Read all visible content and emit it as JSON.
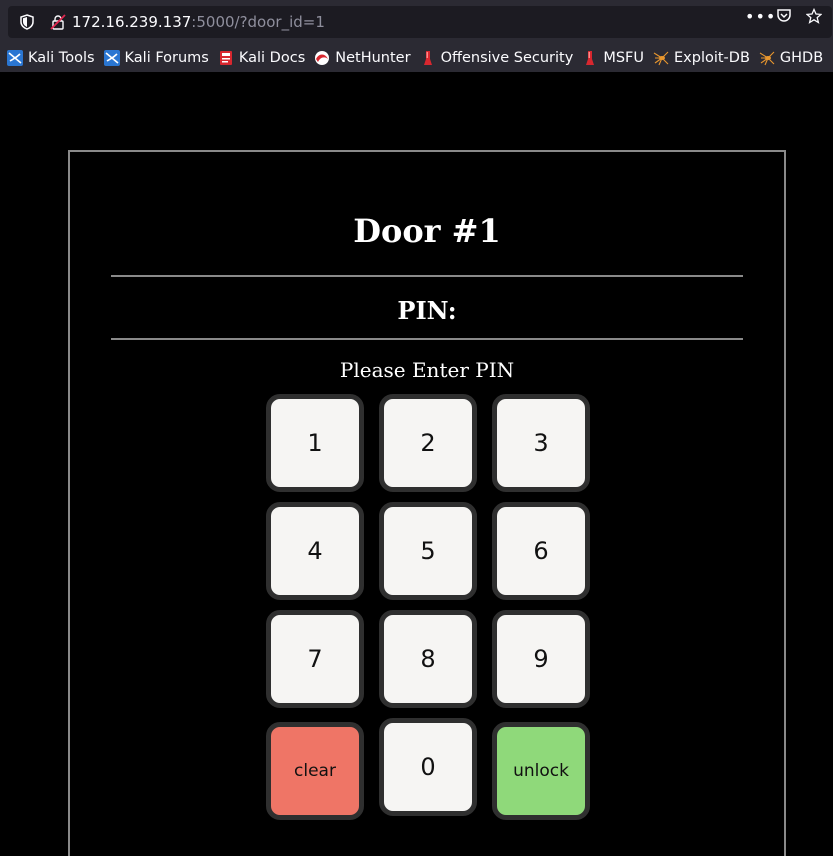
{
  "browser": {
    "url_host": "172.16.239.137",
    "url_rest": ":5000/?door_id=1",
    "more_label": "•••",
    "bookmarks": [
      {
        "label": "Kali Tools",
        "icon": "kali-dragon-icon"
      },
      {
        "label": "Kali Forums",
        "icon": "kali-dragon-icon"
      },
      {
        "label": "Kali Docs",
        "icon": "kali-docs-icon"
      },
      {
        "label": "NetHunter",
        "icon": "nethunter-icon"
      },
      {
        "label": "Offensive Security",
        "icon": "offsec-icon"
      },
      {
        "label": "MSFU",
        "icon": "offsec-icon"
      },
      {
        "label": "Exploit-DB",
        "icon": "exploitdb-spider-icon"
      },
      {
        "label": "GHDB",
        "icon": "exploitdb-spider-icon"
      }
    ]
  },
  "page": {
    "title": "Door #1",
    "pin_label": "PIN:",
    "prompt": "Please Enter PIN",
    "keys": [
      "1",
      "2",
      "3",
      "4",
      "5",
      "6",
      "7",
      "8",
      "9",
      "clear",
      "0",
      "unlock"
    ]
  },
  "colors": {
    "clear": "#ef7566",
    "unlock": "#8fd97a",
    "key": "#f6f5f3"
  }
}
